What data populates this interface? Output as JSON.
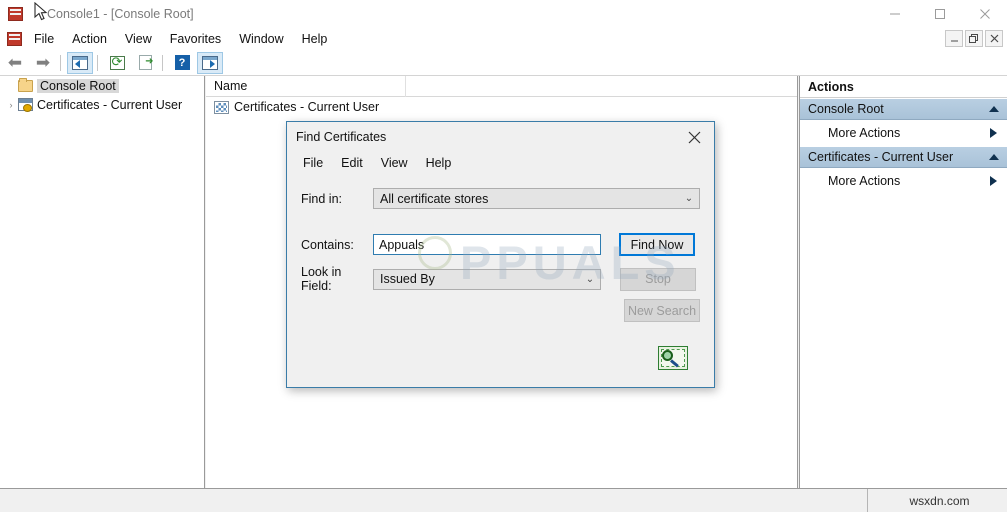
{
  "window": {
    "title": "Console1 - [Console Root]",
    "app_icon": "mmc-console-icon",
    "controls": {
      "minimize": "–",
      "maximize": "□",
      "close": "✕"
    }
  },
  "menubar": {
    "icon": "mmc-console-icon",
    "items": [
      "File",
      "Action",
      "View",
      "Favorites",
      "Window",
      "Help"
    ],
    "mdi_controls": {
      "minimize": "–",
      "restore": "❐",
      "close": "✕"
    }
  },
  "toolbar": {
    "buttons": [
      {
        "name": "back-icon",
        "glyph": "⬅"
      },
      {
        "name": "forward-icon",
        "glyph": "➡"
      },
      {
        "name": "show-hide-console-tree-icon",
        "glyph": ""
      },
      {
        "name": "refresh-icon",
        "glyph": "⟳"
      },
      {
        "name": "export-list-icon",
        "glyph": "➜"
      },
      {
        "name": "help-icon",
        "glyph": "?"
      },
      {
        "name": "show-hide-action-pane-icon",
        "glyph": ""
      }
    ]
  },
  "tree": {
    "items": [
      {
        "label": "Console Root",
        "icon": "folder-icon",
        "selected": true,
        "expander": ""
      },
      {
        "label": "Certificates - Current User",
        "icon": "certificate-store-icon",
        "selected": false,
        "expander": "›"
      }
    ]
  },
  "list": {
    "column_header": "Name",
    "rows": [
      {
        "label": "Certificates - Current User",
        "icon": "certificate-icon"
      }
    ]
  },
  "actions": {
    "title": "Actions",
    "groups": [
      {
        "header": "Console Root",
        "collapse_icon": "chevron-up-icon",
        "items": [
          {
            "label": "More Actions",
            "submenu_icon": "chevron-right-icon"
          }
        ]
      },
      {
        "header": "Certificates - Current User",
        "collapse_icon": "chevron-up-icon",
        "items": [
          {
            "label": "More Actions",
            "submenu_icon": "chevron-right-icon"
          }
        ]
      }
    ]
  },
  "dialog": {
    "title": "Find Certificates",
    "close_icon": "close-icon",
    "menu_items": [
      "File",
      "Edit",
      "View",
      "Help"
    ],
    "fields": {
      "find_in": {
        "label": "Find in:",
        "value": "All certificate stores",
        "arrow_icon": "chevron-down-icon"
      },
      "contains": {
        "label": "Contains:",
        "value": "Appuals",
        "placeholder": ""
      },
      "look_in_field": {
        "label": "Look in Field:",
        "value": "Issued By",
        "arrow_icon": "chevron-down-icon"
      }
    },
    "buttons": [
      {
        "label": "Find Now",
        "state": "default"
      },
      {
        "label": "Stop",
        "state": "disabled"
      },
      {
        "label": "New Search",
        "state": "disabled"
      }
    ],
    "decor_icon": "find-certificate-icon"
  },
  "statusbar": {
    "watermark": "wsxdn.com"
  },
  "overlay": {
    "watermark": "PPUALS"
  },
  "colors": {
    "accent": "#0078d7",
    "dialog_border": "#3a7ca8",
    "actions_header": "#a9c2d8",
    "window_bg": "#f0f0f0"
  }
}
